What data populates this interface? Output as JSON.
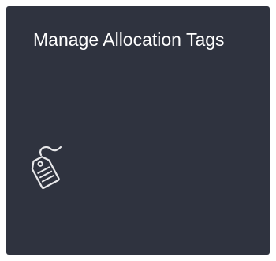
{
  "tile": {
    "title": "Manage Allocation Tags",
    "icon": "tag-icon",
    "background_color": "#2f333f",
    "text_color": "#ffffff"
  }
}
